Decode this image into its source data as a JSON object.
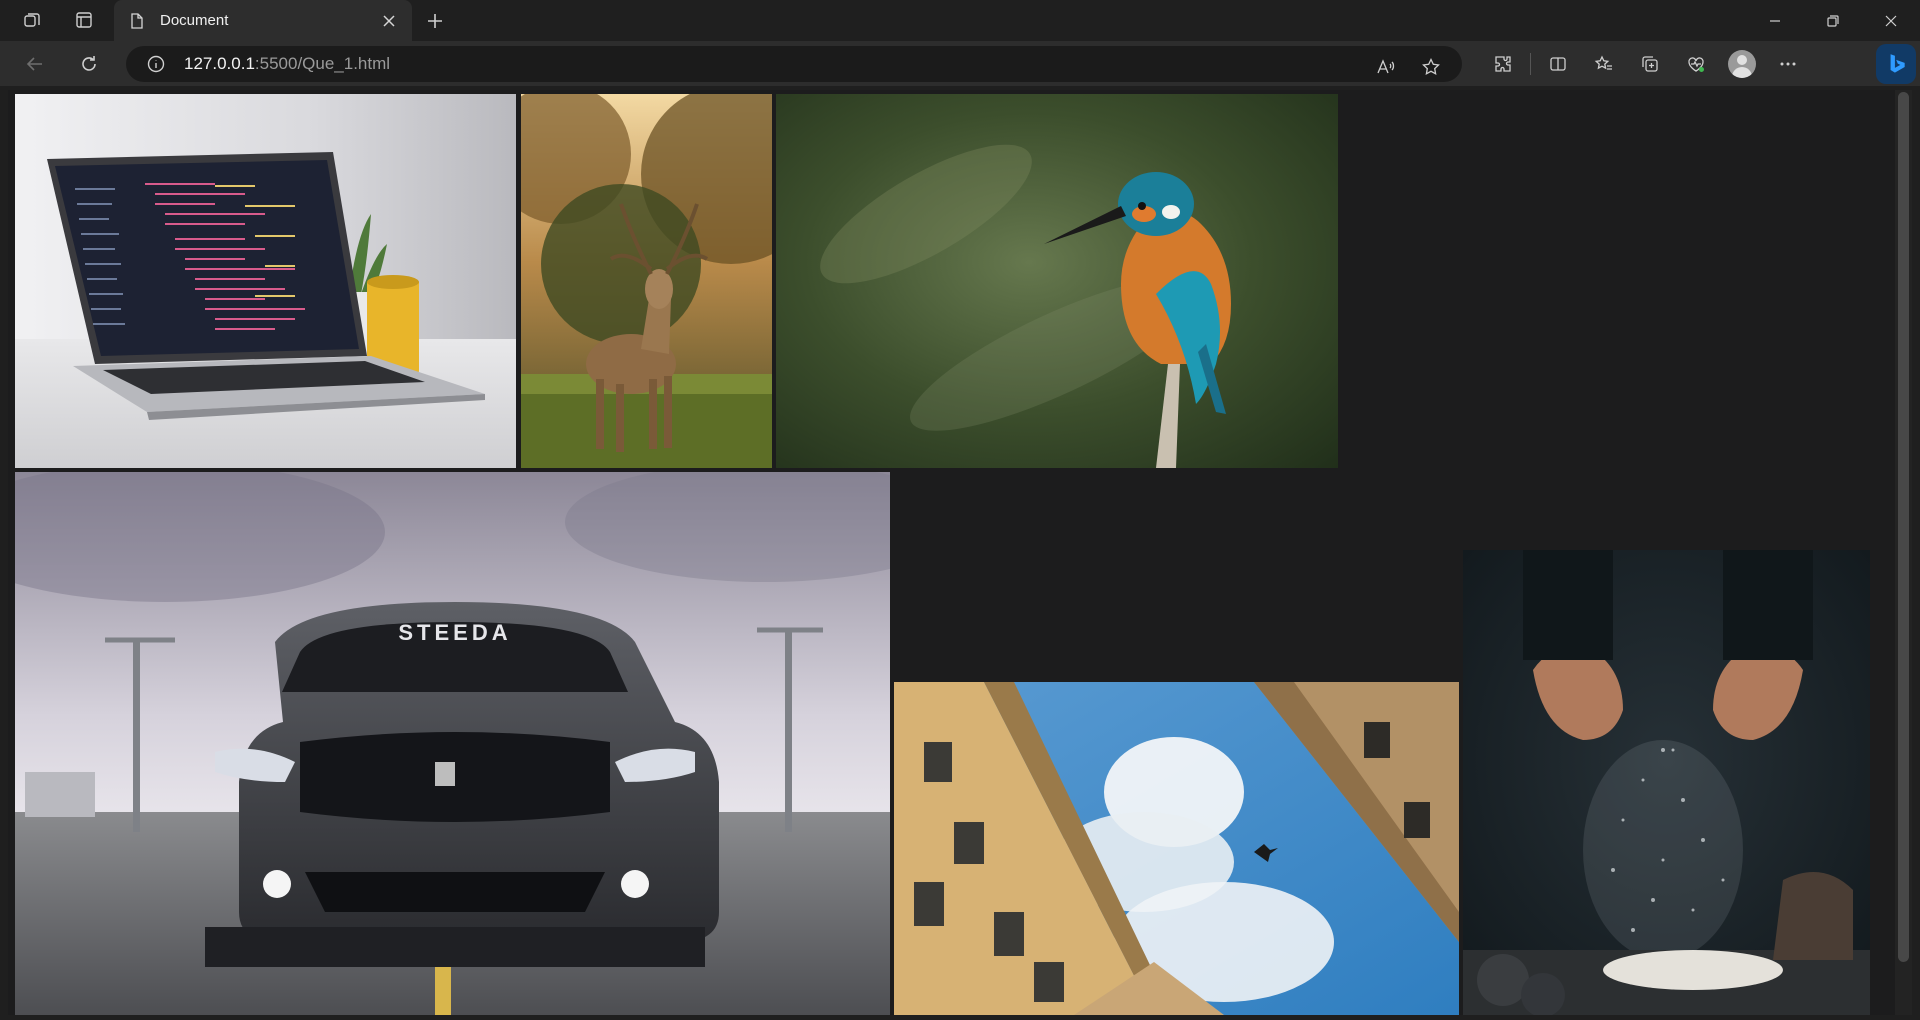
{
  "browser": {
    "tab_title": "Document",
    "url_host": "127.0.0.1",
    "url_rest": ":5500/Que_1.html"
  },
  "gallery": [
    {
      "name": "laptop-photo"
    },
    {
      "name": "deer-photo"
    },
    {
      "name": "kingfisher-photo"
    },
    {
      "name": "mustang-car-photo"
    },
    {
      "name": "building-sky-photo"
    },
    {
      "name": "flour-hands-photo"
    }
  ],
  "colors": {
    "chrome_bg": "#1f1f1f",
    "toolbar_bg": "#2d2d2d",
    "page_bg": "#1c1c1d"
  }
}
